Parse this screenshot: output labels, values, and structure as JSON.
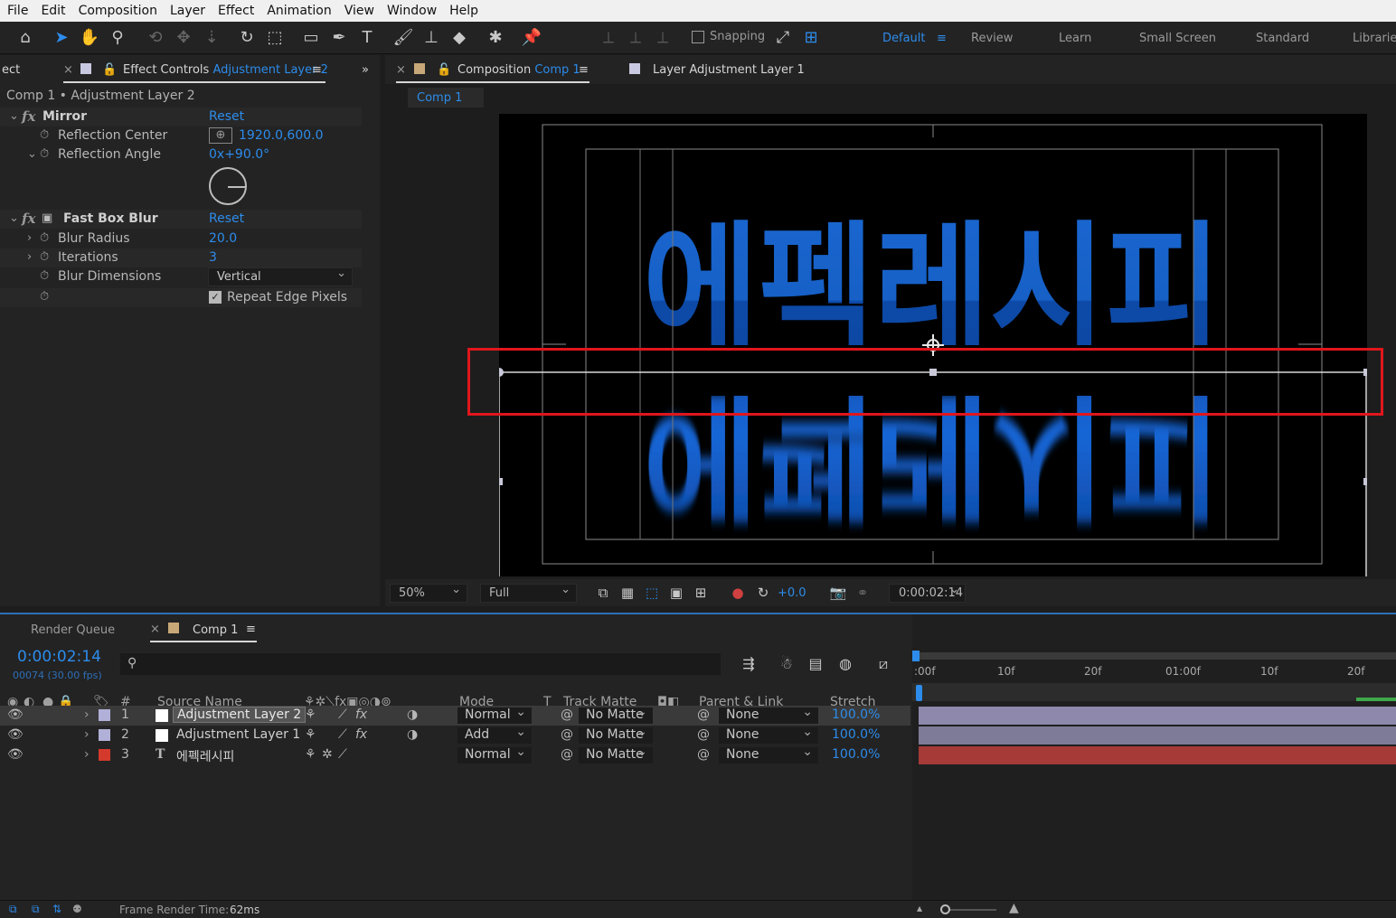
{
  "menu": [
    "File",
    "Edit",
    "Composition",
    "Layer",
    "Effect",
    "Animation",
    "View",
    "Window",
    "Help"
  ],
  "toolbar": {
    "snapping_label": "Snapping",
    "workspaces": [
      "Default",
      "Review",
      "Learn",
      "Small Screen",
      "Standard",
      "Libraries"
    ]
  },
  "effect_controls": {
    "prev_tab": "ect",
    "tab_label": "Effect Controls",
    "tab_layer": "Adjustment Layer 2",
    "breadcrumb": "Comp 1 • Adjustment Layer 2",
    "mirror": {
      "name": "Mirror",
      "reset": "Reset",
      "reflection_center_label": "Reflection Center",
      "reflection_center_value": "1920.0,600.0",
      "reflection_angle_label": "Reflection Angle",
      "reflection_angle_value": "0x+90.0°"
    },
    "fast_box_blur": {
      "name": "Fast Box Blur",
      "reset": "Reset",
      "blur_radius_label": "Blur Radius",
      "blur_radius_value": "20.0",
      "iterations_label": "Iterations",
      "iterations_value": "3",
      "blur_dimensions_label": "Blur Dimensions",
      "blur_dimensions_value": "Vertical",
      "repeat_edge_label": "Repeat Edge Pixels"
    }
  },
  "composition": {
    "tab_label": "Composition",
    "tab_comp": "Comp 1",
    "layer_tab": "Layer Adjustment Layer 1",
    "sub_tab": "Comp 1",
    "text": "에펙레시피",
    "zoom": "50%",
    "resolution": "Full",
    "exposure": "+0.0",
    "timecode": "0:00:02:14"
  },
  "timeline": {
    "render_queue": "Render Queue",
    "comp_tab": "Comp 1",
    "timecode": "0:00:02:14",
    "frame_info": "00074 (30.00 fps)",
    "search_placeholder": "",
    "headers": {
      "num": "#",
      "source_name": "Source Name",
      "mode": "Mode",
      "t": "T",
      "track_matte": "Track Matte",
      "parent": "Parent & Link",
      "stretch": "Stretch"
    },
    "ruler": [
      ":00f",
      "10f",
      "20f",
      "01:00f",
      "10f",
      "20f"
    ],
    "layers": [
      {
        "num": "1",
        "name": "Adjustment Layer 2",
        "mode": "Normal",
        "matte": "No Matte",
        "parent": "None",
        "stretch": "100.0%",
        "label_color": "#b0b0d8",
        "bar_color": "#8a86a8"
      },
      {
        "num": "2",
        "name": "Adjustment Layer 1",
        "mode": "Add",
        "matte": "No Matte",
        "parent": "None",
        "stretch": "100.0%",
        "label_color": "#b0b0d8",
        "bar_color": "#7d7a98"
      },
      {
        "num": "3",
        "name": "에펙레시피",
        "mode": "Normal",
        "matte": "No Matte",
        "parent": "None",
        "stretch": "100.0%",
        "label_color": "#d43a2c",
        "bar_color": "#a33a36"
      }
    ],
    "frame_render_time_label": "Frame Render Time:",
    "frame_render_time_value": "62ms"
  },
  "colors": {
    "accent": "#2d8ceb",
    "highlight_box": "#e0161c",
    "text_fill": "#1560c8"
  }
}
